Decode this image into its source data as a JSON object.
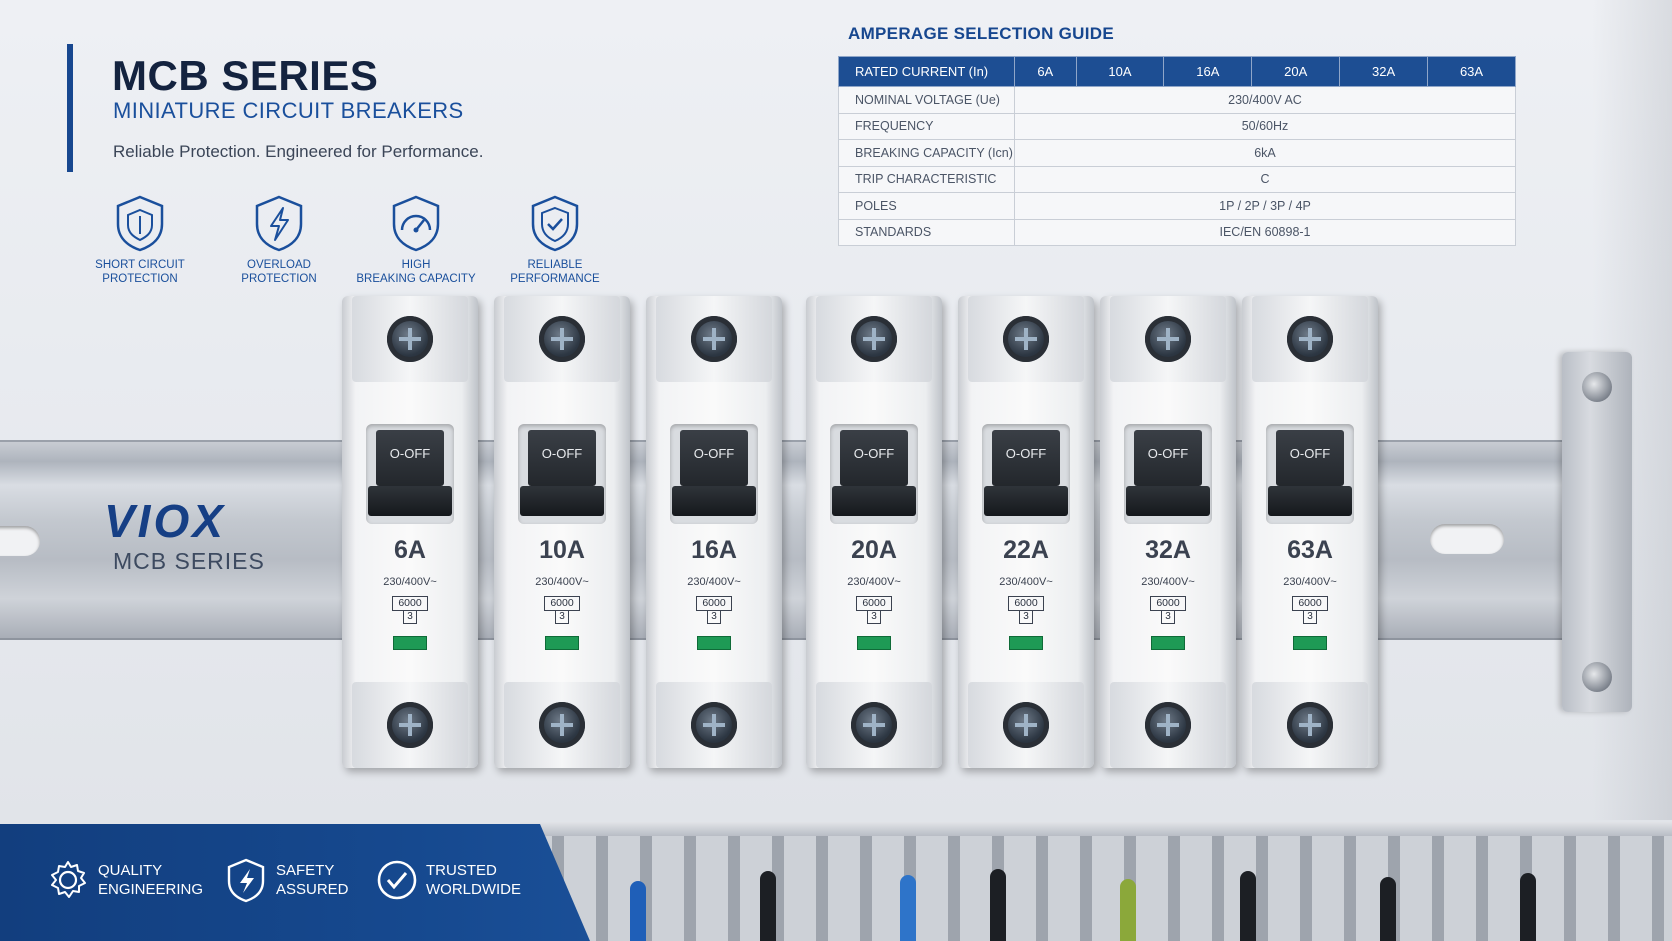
{
  "header": {
    "title": "MCB SERIES",
    "subtitle": "MINIATURE CIRCUIT BREAKERS",
    "tagline": "Reliable Protection. Engineered for Performance."
  },
  "features": [
    {
      "icon": "shield-icon",
      "line1": "SHORT CIRCUIT",
      "line2": "PROTECTION"
    },
    {
      "icon": "lightning-bolt-icon",
      "line1": "OVERLOAD",
      "line2": "PROTECTION"
    },
    {
      "icon": "gauge-icon",
      "line1": "HIGH",
      "line2": "BREAKING CAPACITY"
    },
    {
      "icon": "shield-check-icon",
      "line1": "RELIABLE",
      "line2": "PERFORMANCE"
    }
  ],
  "guide": {
    "title": "AMPERAGE SELECTION GUIDE",
    "header": [
      "RATED CURRENT (In)",
      "6A",
      "10A",
      "16A",
      "20A",
      "32A",
      "63A"
    ],
    "rows": [
      {
        "label": "NOMINAL VOLTAGE (Ue)",
        "value": "230/400V AC"
      },
      {
        "label": "FREQUENCY",
        "value": "50/60Hz"
      },
      {
        "label": "BREAKING CAPACITY (Icn)",
        "value": "6kA"
      },
      {
        "label": "TRIP CHARACTERISTIC",
        "value": "C"
      },
      {
        "label": "POLES",
        "value": "1P / 2P / 3P / 4P"
      },
      {
        "label": "STANDARDS",
        "value": "IEC/EN 60898-1"
      }
    ]
  },
  "brand": {
    "name": "VIOX",
    "series": "MCB SERIES"
  },
  "breakers": [
    {
      "toggle": "O-OFF",
      "rating": "6A",
      "voltage": "230/400V~",
      "capacity": "6000",
      "class": "3"
    },
    {
      "toggle": "O-OFF",
      "rating": "10A",
      "voltage": "230/400V~",
      "capacity": "6000",
      "class": "3"
    },
    {
      "toggle": "O-OFF",
      "rating": "16A",
      "voltage": "230/400V~",
      "capacity": "6000",
      "class": "3"
    },
    {
      "toggle": "O-OFF",
      "rating": "20A",
      "voltage": "230/400V~",
      "capacity": "6000",
      "class": "3"
    },
    {
      "toggle": "O-OFF",
      "rating": "22A",
      "voltage": "230/400V~",
      "capacity": "6000",
      "class": "3"
    },
    {
      "toggle": "O-OFF",
      "rating": "32A",
      "voltage": "230/400V~",
      "capacity": "6000",
      "class": "3"
    },
    {
      "toggle": "O-OFF",
      "rating": "63A",
      "voltage": "230/400V~",
      "capacity": "6000",
      "class": "3"
    }
  ],
  "footer": [
    {
      "icon": "gear-icon",
      "line1": "QUALITY",
      "line2": "ENGINEERING"
    },
    {
      "icon": "shield-bolt-icon",
      "line1": "SAFETY",
      "line2": "ASSURED"
    },
    {
      "icon": "check-circle-icon",
      "line1": "TRUSTED",
      "line2": "WORLDWIDE"
    }
  ],
  "colors": {
    "brand_blue": "#17478f",
    "accent_blue": "#1a4f9c",
    "indicator_green": "#1e9a55"
  }
}
